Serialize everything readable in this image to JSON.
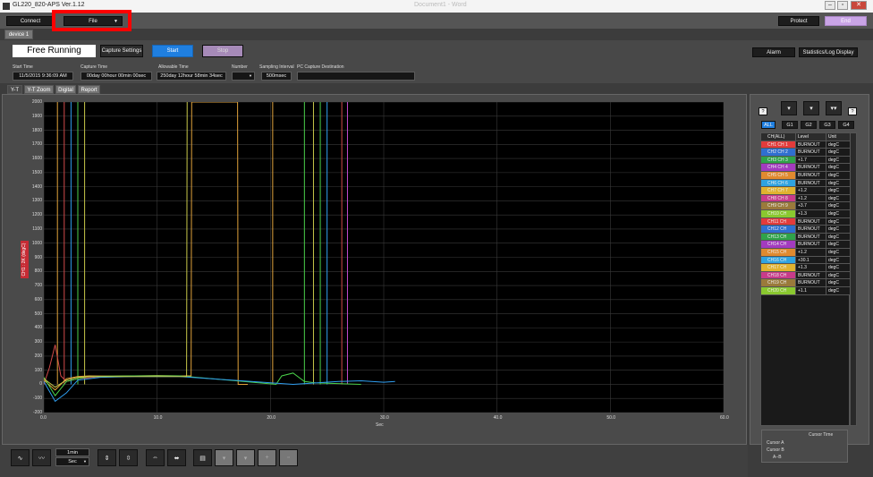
{
  "window": {
    "title": "GL220_820-APS Ver.1.12",
    "ghost_title": "Document1 - Word",
    "minimize": "–",
    "restore": "▫",
    "close": "✕"
  },
  "topbar": {
    "connect": "Connect",
    "file": "File",
    "protect": "Protect",
    "exit": "End"
  },
  "device_tab": "device 1",
  "status": {
    "mode": "Free Running",
    "capture_settings": "Capture Settings",
    "start": "Start",
    "stop": "Stop"
  },
  "right_buttons": {
    "alarm": "Alarm",
    "stats": "Statistics/Log Display"
  },
  "info": {
    "start_time_label": "Start Time",
    "start_time": "11/5/2015 9:36:09 AM",
    "capture_time_label": "Capture Time",
    "capture_time": "00day 00hour 00min 00sec",
    "allowable_label": "Allowable Time",
    "allowable": "250day 12hour 58min 34sec",
    "number_label": "Number",
    "number": "",
    "sampling_label": "Sampling Interval",
    "sampling": "500msec",
    "dest_label": "PC Capture Destination",
    "dest": ""
  },
  "tabs": [
    "Y-T",
    "Y-T Zoom",
    "Digital",
    "Report"
  ],
  "chart_data": {
    "type": "line",
    "ylabel": "CH1 : 2K (degC)",
    "xlabel": "Sec",
    "ylim": [
      -200,
      2000
    ],
    "xlim": [
      0,
      60
    ],
    "yticks": [
      "2000",
      "1900",
      "1800",
      "1700",
      "1600",
      "1500",
      "1400",
      "1300",
      "1200",
      "1100",
      "1000",
      "900",
      "800",
      "700",
      "600",
      "500",
      "400",
      "300",
      "200",
      "100",
      "0",
      "-100",
      "-200"
    ],
    "xticks": [
      "0.0",
      "10.0",
      "20.0",
      "30.0",
      "40.0",
      "50.0",
      "60.0"
    ],
    "grid": true,
    "series": [
      {
        "color": "#d24a4a",
        "x": [
          0,
          0.5,
          1,
          1.5,
          2,
          3,
          5,
          8,
          12
        ],
        "y": [
          0,
          120,
          280,
          60,
          20,
          40,
          55,
          60,
          60
        ]
      },
      {
        "color": "#e0a23b",
        "x": [
          0,
          1,
          2,
          3,
          4,
          6,
          8,
          10,
          12,
          13,
          13.05,
          17.1,
          17.15,
          18
        ],
        "y": [
          30,
          -40,
          40,
          55,
          60,
          58,
          60,
          62,
          60,
          60,
          2000,
          2000,
          0,
          0
        ]
      },
      {
        "color": "#4ad14a",
        "x": [
          0,
          1,
          2,
          3,
          4,
          6,
          8,
          10,
          12,
          20.5,
          21,
          22,
          23,
          24,
          26,
          28
        ],
        "y": [
          50,
          -80,
          20,
          40,
          55,
          58,
          60,
          60,
          60,
          0,
          60,
          80,
          20,
          10,
          5,
          0
        ]
      },
      {
        "color": "#2f9ef0",
        "x": [
          0,
          1,
          2,
          3,
          5,
          8,
          12,
          22,
          24,
          26,
          28,
          30,
          31
        ],
        "y": [
          20,
          -120,
          -60,
          30,
          50,
          55,
          55,
          0,
          10,
          20,
          25,
          15,
          20
        ]
      },
      {
        "color": "#c8c84a",
        "x": [
          0,
          1,
          2,
          3,
          4,
          6,
          9,
          12,
          12.6,
          12.65
        ],
        "y": [
          40,
          -20,
          30,
          50,
          55,
          55,
          55,
          55,
          55,
          2000
        ]
      }
    ],
    "spikes": [
      {
        "x": 1.2,
        "color": "#e0a23b"
      },
      {
        "x": 1.8,
        "color": "#d24a4a"
      },
      {
        "x": 2.4,
        "color": "#2f9ef0"
      },
      {
        "x": 3.0,
        "color": "#4ad14a"
      },
      {
        "x": 3.6,
        "color": "#c8c84a"
      },
      {
        "x": 20.2,
        "color": "#e0a23b"
      },
      {
        "x": 23.0,
        "color": "#4ad14a"
      },
      {
        "x": 23.8,
        "color": "#c8c84a"
      },
      {
        "x": 24.4,
        "color": "#4ad14a"
      },
      {
        "x": 25.0,
        "color": "#2f9ef0"
      },
      {
        "x": 26.3,
        "color": "#d24a4a"
      },
      {
        "x": 26.8,
        "color": "#c44ad0"
      }
    ]
  },
  "bottom": {
    "time_per_div": "1min",
    "time_unit": "Sec"
  },
  "groups": [
    "ALL",
    "G1",
    "G2",
    "G3",
    "G4"
  ],
  "table": {
    "headers": [
      "CH(ALL)",
      "Level",
      "Unit"
    ],
    "rows": [
      {
        "ch": "CH1 CH 1",
        "level": "BURNOUT",
        "unit": "degC",
        "color": "#e33b3b"
      },
      {
        "ch": "CH2 CH 2",
        "level": "BURNOUT",
        "unit": "degC",
        "color": "#2f6fd0"
      },
      {
        "ch": "CH3 CH 3",
        "level": "+1.7",
        "unit": "degC",
        "color": "#2fa34a"
      },
      {
        "ch": "CH4 CH 4",
        "level": "BURNOUT",
        "unit": "degC",
        "color": "#a33bbf"
      },
      {
        "ch": "CH5 CH 5",
        "level": "BURNOUT",
        "unit": "degC",
        "color": "#e08a2f"
      },
      {
        "ch": "CH6 CH 6",
        "level": "BURNOUT",
        "unit": "degC",
        "color": "#2fa3e0"
      },
      {
        "ch": "CH7 CH 7",
        "level": "+1.2",
        "unit": "degC",
        "color": "#e0b22f"
      },
      {
        "ch": "CH8 CH 8",
        "level": "+1.2",
        "unit": "degC",
        "color": "#c83b8a"
      },
      {
        "ch": "CH9 CH 9",
        "level": "+3.7",
        "unit": "degC",
        "color": "#9a7a3b"
      },
      {
        "ch": "CH10 CH",
        "level": "+1.3",
        "unit": "degC",
        "color": "#8ac82f"
      },
      {
        "ch": "CH11 CH",
        "level": "BURNOUT",
        "unit": "degC",
        "color": "#e33b3b"
      },
      {
        "ch": "CH12 CH",
        "level": "BURNOUT",
        "unit": "degC",
        "color": "#2f6fd0"
      },
      {
        "ch": "CH13 CH",
        "level": "BURNOUT",
        "unit": "degC",
        "color": "#2fa34a"
      },
      {
        "ch": "CH14 CH",
        "level": "BURNOUT",
        "unit": "degC",
        "color": "#a33bbf"
      },
      {
        "ch": "CH15 CH",
        "level": "+1.2",
        "unit": "degC",
        "color": "#e08a2f"
      },
      {
        "ch": "CH16 CH",
        "level": "+30.1",
        "unit": "degC",
        "color": "#2fa3e0"
      },
      {
        "ch": "CH17 CH",
        "level": "+1.3",
        "unit": "degC",
        "color": "#e0b22f"
      },
      {
        "ch": "CH18 CH",
        "level": "BURNOUT",
        "unit": "degC",
        "color": "#c83b8a"
      },
      {
        "ch": "CH19 CH",
        "level": "BURNOUT",
        "unit": "degC",
        "color": "#9a7a3b"
      },
      {
        "ch": "CH20 CH",
        "level": "+1.1",
        "unit": "degC",
        "color": "#8ac82f"
      }
    ]
  },
  "cursor": {
    "header": "Cursor Time",
    "a": "Cursor A",
    "b": "Cursor B",
    "diff": "A−B"
  },
  "icons": {
    "help": "?",
    "add": "+"
  },
  "colors": {
    "accent": "#1f7fe0",
    "end": "#c9a4e6",
    "highlight": "#ff0000"
  }
}
